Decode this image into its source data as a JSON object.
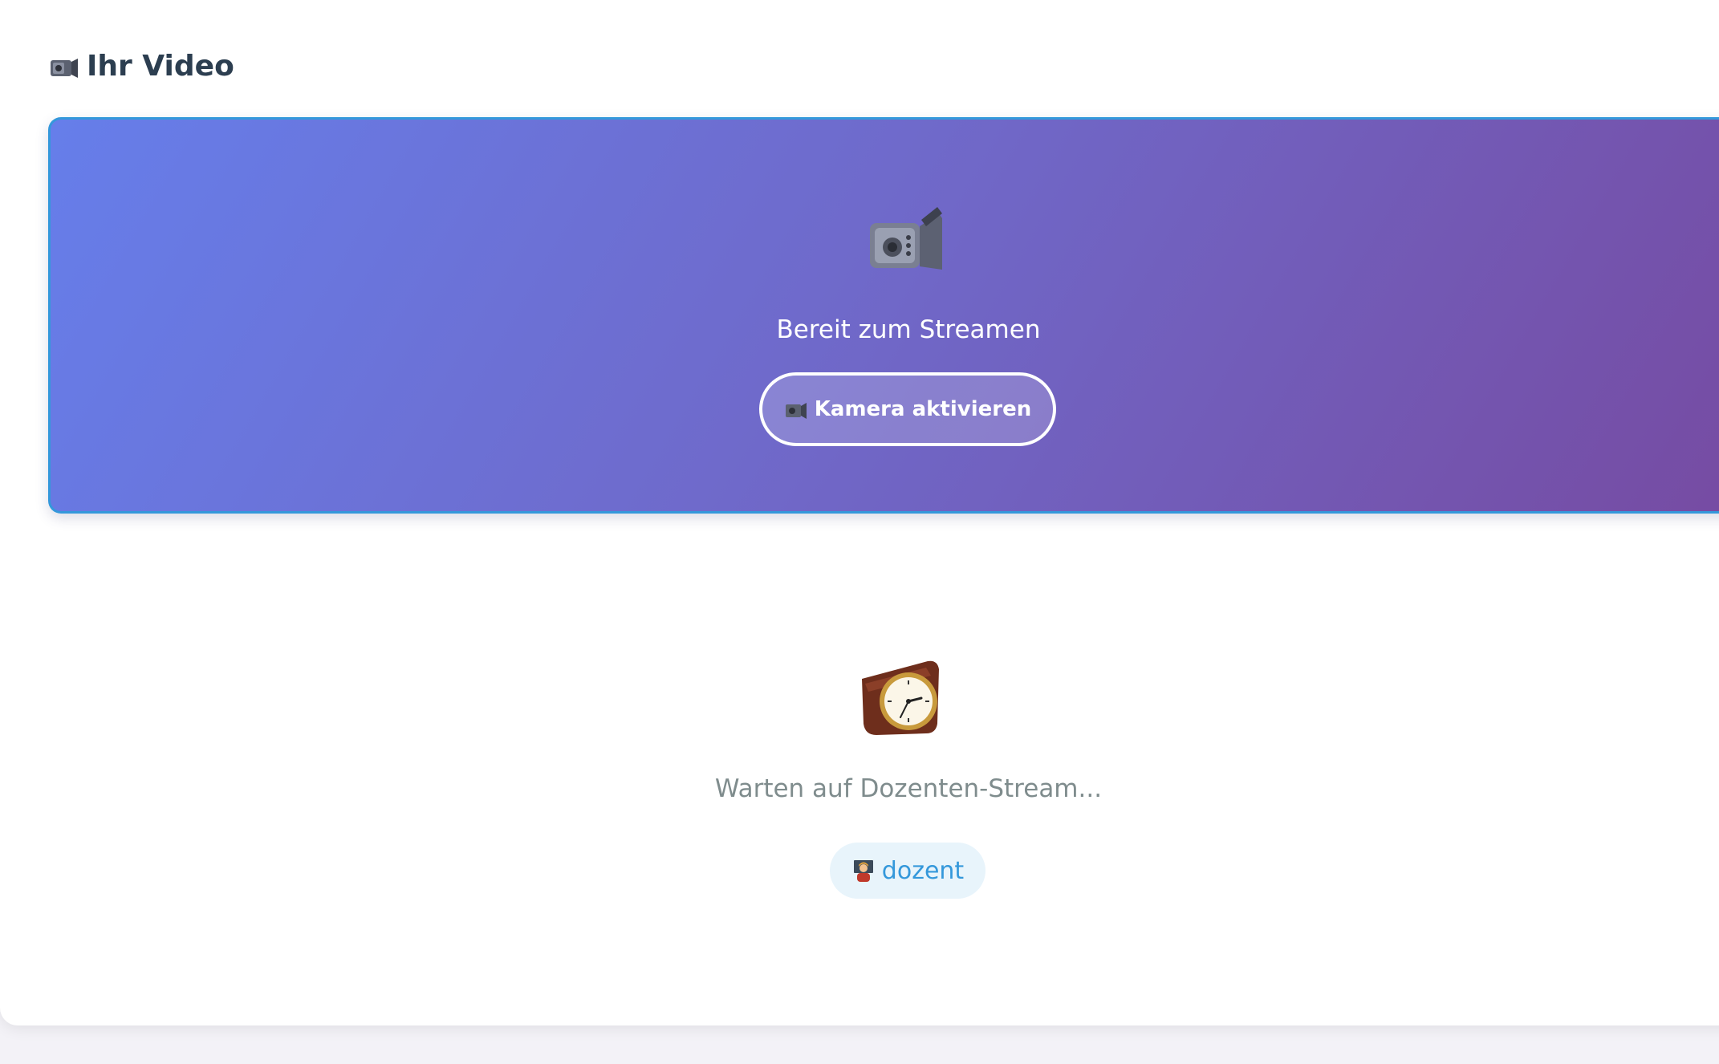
{
  "section": {
    "title": "Ihr Video",
    "title_icon": "video-camera-icon"
  },
  "video_panel": {
    "status_text": "Bereit zum Streamen",
    "camera_icon": "video-camera-icon",
    "activate_button_label": "Kamera aktivieren",
    "activate_button_icon": "video-camera-icon",
    "gradient_start": "#667eea",
    "gradient_end": "#764ba2",
    "border_color": "#3498db"
  },
  "waiting": {
    "icon": "mantelpiece-clock-icon",
    "text": "Warten auf Dozenten-Stream...",
    "role_badge_icon": "teacher-icon",
    "role_badge_label": "dozent"
  },
  "colors": {
    "heading": "#2c3e50",
    "muted_text": "#7f8c8d",
    "accent": "#3498db",
    "badge_bg": "#e8f4fb"
  }
}
